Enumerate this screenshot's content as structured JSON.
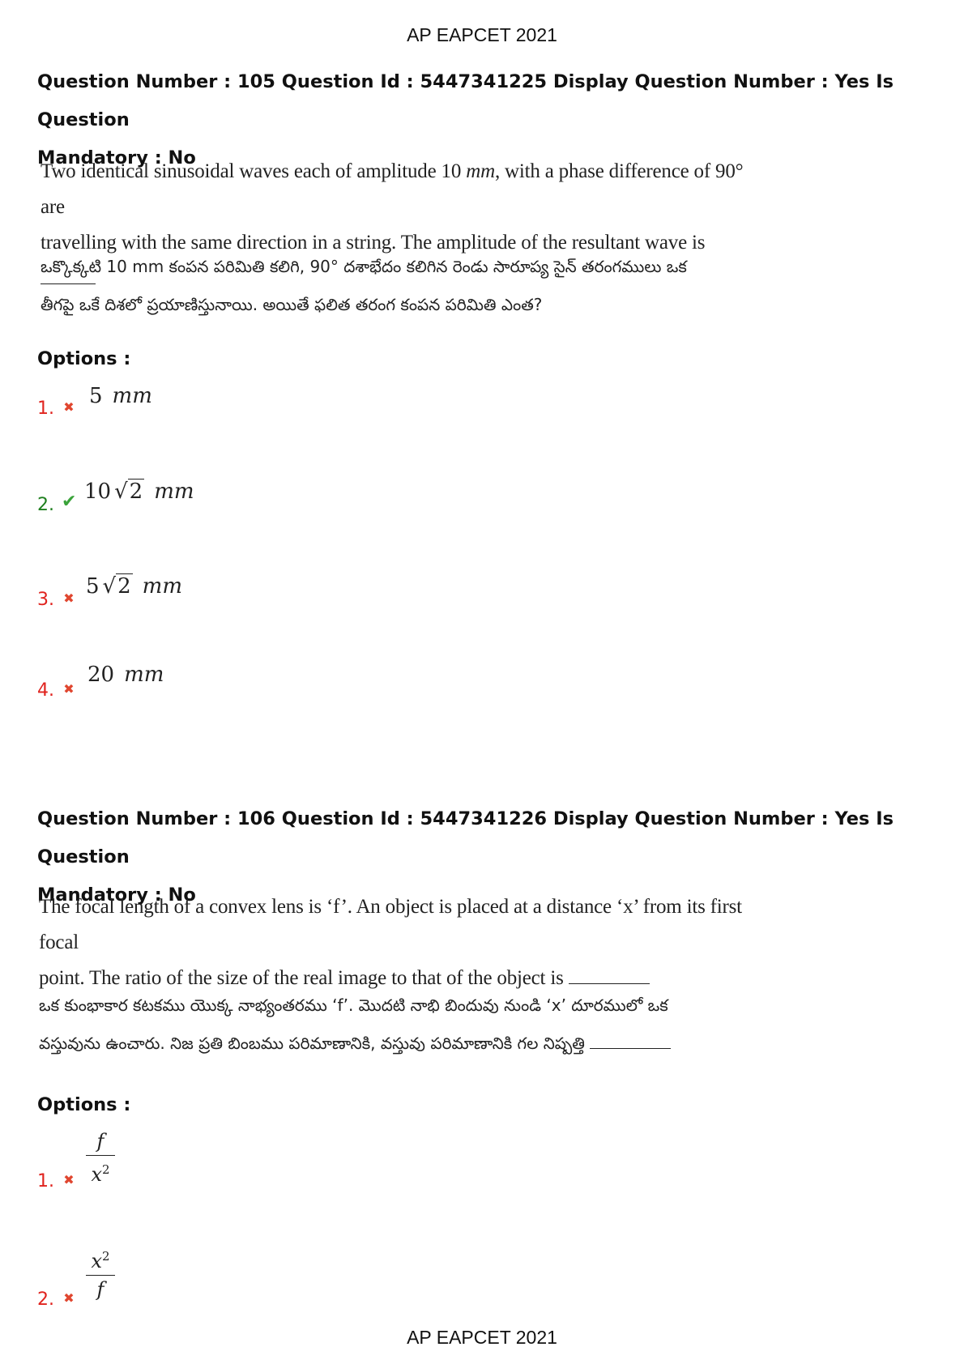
{
  "header": {
    "title": "AP EAPCET 2021"
  },
  "footer": {
    "title": "AP EAPCET 2021"
  },
  "questions": [
    {
      "meta_line1": "Question Number : 105 Question Id : 5447341225 Display Question Number : Yes Is Question",
      "meta_line2": "Mandatory : No",
      "en_line1_a": "Two identical sinusoidal waves each of amplitude 10 ",
      "en_line1_unit": "mm",
      "en_line1_b": ", with a phase difference of 90° are",
      "en_line2": "travelling with the same direction in a string. The amplitude of the resultant wave is",
      "te_line1": "ఒక్కొక్కటి 10 mm కంపన పరిమితి కలిగి, 90° దశాభేదం కలిగిన రెండు సారూప్య సైన్ తరంగములు ఒక",
      "te_line2": "తీగపై ఒకే దిశలో ప్రయాణిస్తునాయి. అయితే ఫలిత తరంగ కంపన పరిమితి ఎంత?",
      "options_label": "Options :",
      "options": [
        {
          "num": "1.",
          "status": "wrong",
          "value": "5",
          "unit": "mm"
        },
        {
          "num": "2.",
          "status": "correct",
          "coef": "10",
          "radicand": "2",
          "unit": "mm"
        },
        {
          "num": "3.",
          "status": "wrong",
          "coef": "5",
          "radicand": "2",
          "unit": "mm"
        },
        {
          "num": "4.",
          "status": "wrong",
          "value": "20",
          "unit": "mm"
        }
      ]
    },
    {
      "meta_line1": "Question Number : 106 Question Id : 5447341226 Display Question Number : Yes Is Question",
      "meta_line2": "Mandatory : No",
      "en_line1": "The focal length of a convex lens is ‘f’. An object is placed at a distance ‘x’ from its first focal",
      "en_line2": "point. The ratio of the size of the real image to that of the object is",
      "te_line1": "ఒక కుంభాకార కటకము యొక్క నాభ్యంతరము ‘f’. మొదటి నాభి బిందువు నుండి ‘x’ దూరములో ఒక",
      "te_line2": "వస్తువును ఉంచారు. నిజ ప్రతి బింబము పరిమాణానికి, వస్తువు పరిమాణానికి గల నిష్పత్తి",
      "options_label": "Options :",
      "options": [
        {
          "num": "1.",
          "status": "wrong",
          "numerator": "f",
          "denominator": "x",
          "den_exp": "2"
        },
        {
          "num": "2.",
          "status": "wrong",
          "numerator": "x",
          "num_exp": "2",
          "denominator": "f"
        }
      ]
    }
  ],
  "marks": {
    "wrong": "✖",
    "correct": "✔"
  },
  "colors": {
    "wrong": "#e0231e",
    "correct": "#1e7f1e"
  }
}
